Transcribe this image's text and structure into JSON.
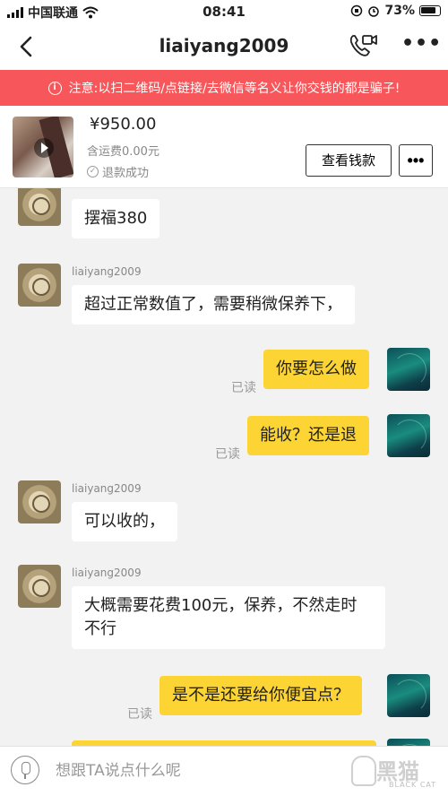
{
  "status_bar": {
    "carrier": "中国联通",
    "time": "08:41",
    "battery": "73%"
  },
  "header": {
    "title": "liaiyang2009"
  },
  "warning": {
    "text": "注意:以扫二维码/点链接/去微信等名义让你交钱的都是骗子!"
  },
  "product": {
    "price": "¥950.00",
    "shipping": "含运费0.00元",
    "status": "退款成功",
    "view_button": "查看钱款",
    "more_button": "•••"
  },
  "chat": {
    "messages": [
      {
        "side": "in",
        "sender": "",
        "text": "摆福380"
      },
      {
        "side": "in",
        "sender": "liaiyang2009",
        "text": "超过正常数值了，需要稍微保养下，"
      },
      {
        "side": "out",
        "read": "已读",
        "text": "你要怎么做"
      },
      {
        "side": "out",
        "read": "已读",
        "text": "能收？还是退"
      },
      {
        "side": "in",
        "sender": "liaiyang2009",
        "text": "可以收的，"
      },
      {
        "side": "in",
        "sender": "liaiyang2009",
        "text": "大概需要花费100元，保养，不然走时不行"
      },
      {
        "side": "out",
        "read": "已读",
        "text": "是不是还要给你便宜点？"
      }
    ]
  },
  "input": {
    "placeholder": "想跟TA说点什么呢"
  },
  "watermark": {
    "main": "黑猫",
    "sub": "BLACK CAT"
  }
}
